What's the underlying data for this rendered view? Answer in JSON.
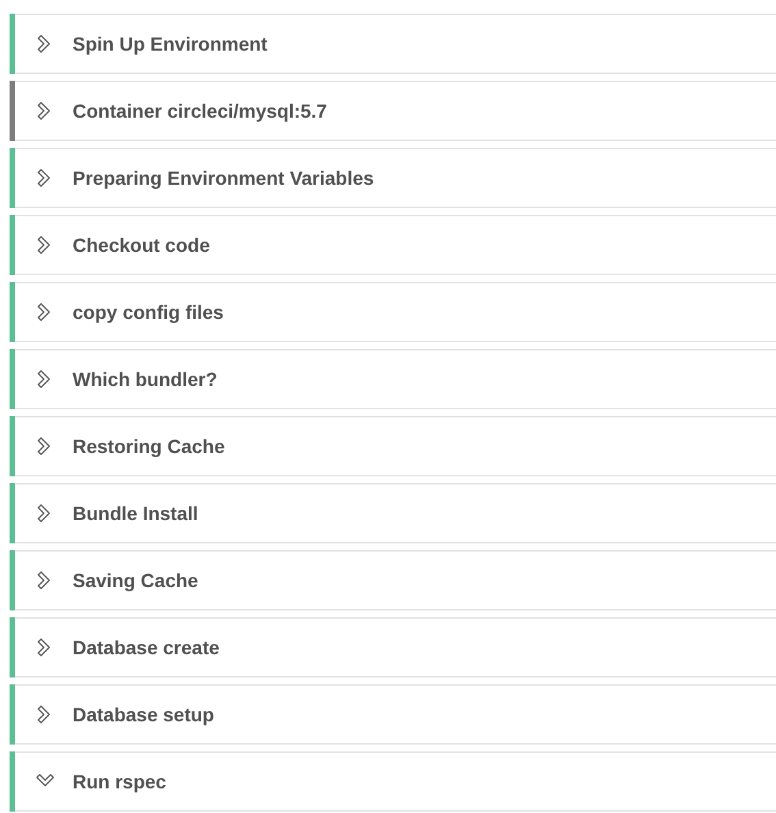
{
  "steps": [
    {
      "title": "Spin Up Environment",
      "color": "#5cbf93",
      "expanded": false
    },
    {
      "title": "Container circleci/mysql:5.7",
      "color": "#7d7d7d",
      "expanded": false
    },
    {
      "title": "Preparing Environment Variables",
      "color": "#5cbf93",
      "expanded": false
    },
    {
      "title": "Checkout code",
      "color": "#5cbf93",
      "expanded": false
    },
    {
      "title": "copy config files",
      "color": "#5cbf93",
      "expanded": false
    },
    {
      "title": "Which bundler?",
      "color": "#5cbf93",
      "expanded": false
    },
    {
      "title": "Restoring Cache",
      "color": "#5cbf93",
      "expanded": false
    },
    {
      "title": "Bundle Install",
      "color": "#5cbf93",
      "expanded": false
    },
    {
      "title": "Saving Cache",
      "color": "#5cbf93",
      "expanded": false
    },
    {
      "title": "Database create",
      "color": "#5cbf93",
      "expanded": false
    },
    {
      "title": "Database setup",
      "color": "#5cbf93",
      "expanded": false
    },
    {
      "title": "Run rspec",
      "color": "#5cbf93",
      "expanded": true
    }
  ]
}
